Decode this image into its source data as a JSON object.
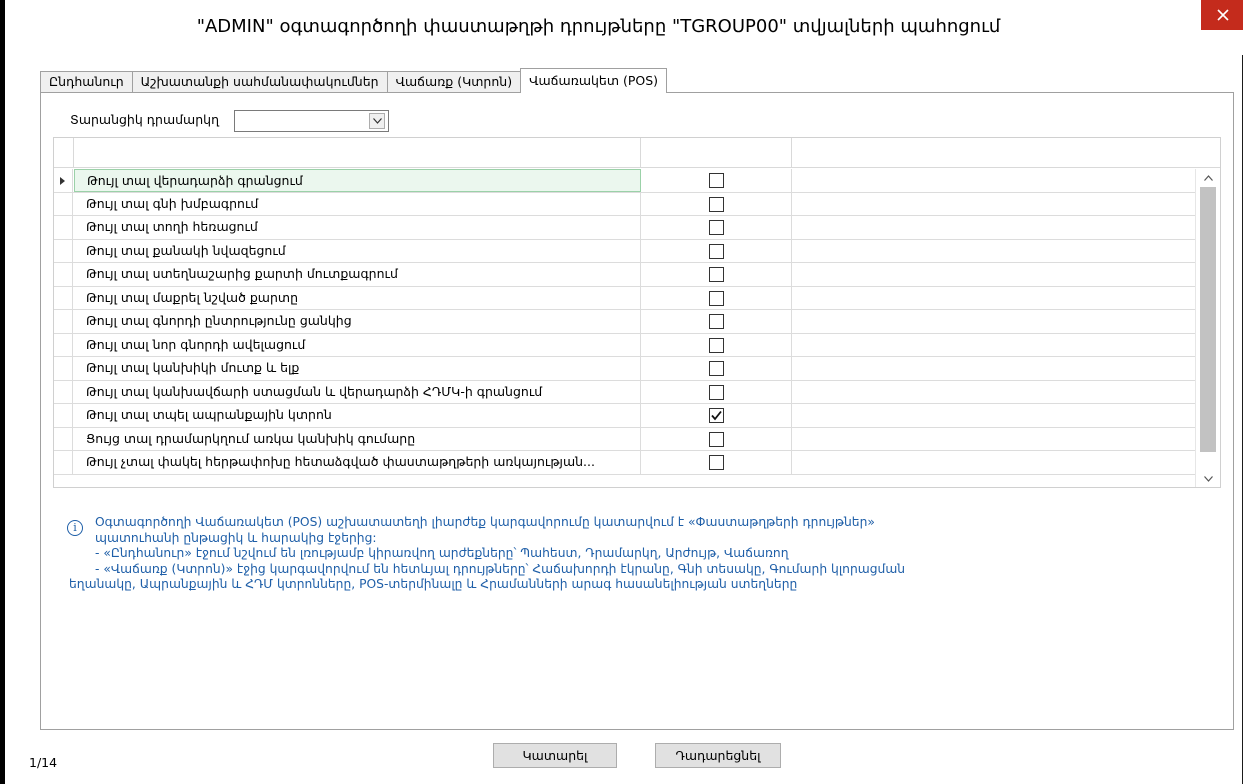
{
  "window": {
    "title": "\"ADMIN\" oգտագործողի փաստաթղթի դրույթները \"TGROUP00\" տվյալների պահոցում",
    "close_glyph": "close-icon"
  },
  "tabs": [
    {
      "label": "Ընդհանուր",
      "active": false
    },
    {
      "label": "Աշխատանքի սահմանափակումներ",
      "active": false
    },
    {
      "label": "Վաճառք (Կտրոն)",
      "active": false
    },
    {
      "label": "Վաճառակետ (POS)",
      "active": true
    }
  ],
  "currency": {
    "label": "Տարանցիկ դրամարկղ",
    "value": ""
  },
  "grid": {
    "rows": [
      {
        "label": "Թույլ տալ վերադարձի գրանցում",
        "checked": false
      },
      {
        "label": "Թույլ տալ գնի խմբագրում",
        "checked": false
      },
      {
        "label": "Թույլ տալ տողի հեռացում",
        "checked": false
      },
      {
        "label": "Թույլ տալ քանակի նվազեցում",
        "checked": false
      },
      {
        "label": "Թույլ տալ ստեղնաշարից քարտի մուտքագրում",
        "checked": false
      },
      {
        "label": "Թույլ տալ մաքրել նշված քարտը",
        "checked": false
      },
      {
        "label": "Թույլ տալ գնորդի ընտրությունը ցանկից",
        "checked": false
      },
      {
        "label": "Թույլ տալ նոր գնորդի ավելացում",
        "checked": false
      },
      {
        "label": "Թույլ տալ կանխիկի մուտք և ելք",
        "checked": false
      },
      {
        "label": "Թույլ տալ կանխավճարի ստացման և վերադարձի ՀԴՄԿ-ի գրանցում",
        "checked": false
      },
      {
        "label": "Թույլ տալ տպել ապրանքային կտրոն",
        "checked": true
      },
      {
        "label": "Ցույց տալ դրամարկղում առկա կանխիկ գումարը",
        "checked": false
      },
      {
        "label": "Թույլ չտալ փակել հերթափոխը հետաձգված փաստաթղթերի առկայության...",
        "checked": false
      }
    ]
  },
  "info": {
    "lines": [
      "Oգտագործողի Վաճառակետ (POS) աշխատատեղի լիարժեք կարգավորումը կատարվում է «Փաստաթղթերի դրույթներ»",
      "պատուհանի ընթացիկ և հարակից էջերից:",
      " -  «Ընդհանուր» էջում նշվում են լռությամբ կիրառվող արժեքները՝ Պահեստ, Դրամարկղ, Արժույթ, Վաճառող",
      " -  «Վաճառք (Կտրոն)» էջից կարգավորվում են հետևյալ դրույթները՝ Հաճախորդի էկրանը, Գնի տեսակը, Գումարի կլորացման",
      "եղանակը, Ապրանքային և ՀԴՄ կտրոնները, POS-տերմինալը և Հրամանների արագ հասանելիության ստեղները"
    ]
  },
  "status": {
    "record_position": "1/14"
  },
  "buttons": {
    "ok_label": "Կատարել",
    "cancel_label": "Դադարեցնել"
  }
}
